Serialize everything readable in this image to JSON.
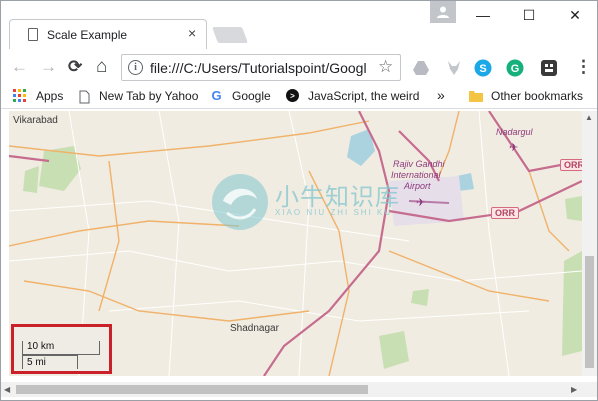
{
  "window": {
    "tab_title": "Scale Example",
    "tab_close": "×",
    "minimize": "—",
    "maximize": "☐",
    "close": "✕"
  },
  "toolbar": {
    "back": "←",
    "forward": "→",
    "reload": "⟳",
    "home": "⌂",
    "info": "i",
    "url": "file:///C:/Users/Tutorialspoint/Googl",
    "star": "☆",
    "menu": "⋮"
  },
  "bookmarks": {
    "apps": "Apps",
    "new_tab": "New Tab by Yahoo",
    "google": "Google",
    "javascript": "JavaScript, the weird",
    "more": "»",
    "other": "Other bookmarks"
  },
  "map": {
    "labels": {
      "vikarabad": "Vikarabad",
      "nadargul": "Nadargul",
      "airport_line1": "Rajiv Gandhi",
      "airport_line2": "International",
      "airport_line3": "Airport",
      "shadnagar": "Shadnagar",
      "orr": "ORR"
    },
    "watermark": {
      "chinese": "小牛知识库",
      "pinyin": "XIAO NIU ZHI SHI KU"
    },
    "scale": {
      "km": "10 km",
      "mi": "5 mi"
    }
  },
  "colors": {
    "scale_highlight": "#c9202a",
    "map_background": "#f1ece1",
    "highway": "#c56c8f",
    "road": "#f0b26a"
  }
}
